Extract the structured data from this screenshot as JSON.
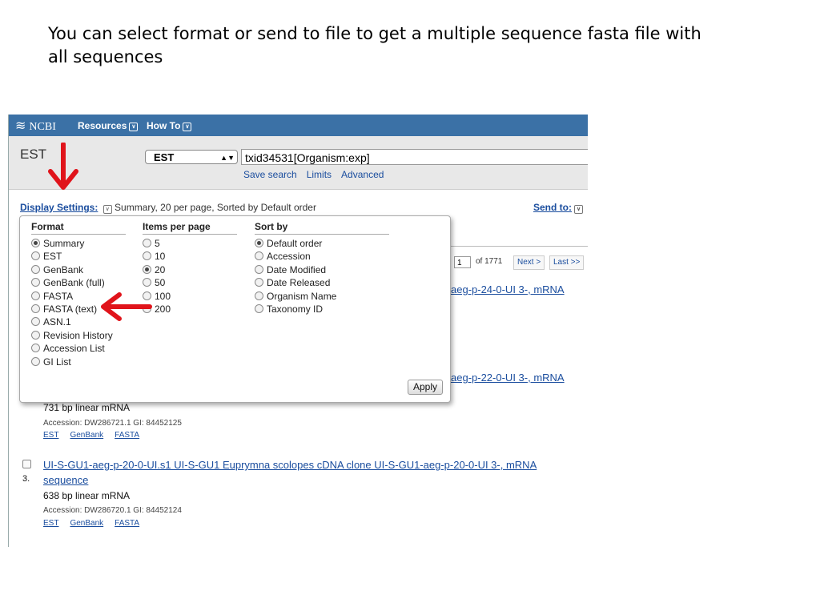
{
  "caption": "You can select format or send to file to get a multiple sequence fasta file with all sequences",
  "header": {
    "logo": "NCBI",
    "resources": "Resources",
    "howto": "How To"
  },
  "search": {
    "db_title": "EST",
    "db_select": "EST",
    "term": "txid34531[Organism:exp]",
    "save_search": "Save search",
    "limits": "Limits",
    "advanced": "Advanced"
  },
  "display": {
    "label": "Display Settings:",
    "summary": "Summary, 20 per page, Sorted by Default order",
    "send_to": "Send to:"
  },
  "pager": {
    "page": "1",
    "of": "of 1771",
    "next": "Next >",
    "last": "Last >>"
  },
  "panel": {
    "format_head": "Format",
    "format_options": [
      "Summary",
      "EST",
      "GenBank",
      "GenBank (full)",
      "FASTA",
      "FASTA (text)",
      "ASN.1",
      "Revision History",
      "Accession List",
      "GI List"
    ],
    "format_selected": "Summary",
    "items_head": "Items per page",
    "items_options": [
      "5",
      "10",
      "20",
      "50",
      "100",
      "200"
    ],
    "items_selected": "20",
    "sort_head": "Sort by",
    "sort_options": [
      "Default order",
      "Accession",
      "Date Modified",
      "Date Released",
      "Organism Name",
      "Taxonomy ID"
    ],
    "sort_selected": "Default order",
    "apply": "Apply"
  },
  "results": [
    {
      "title_tail": "aeg-p-24-0-UI 3-, mRNA"
    },
    {
      "title_tail": "aeg-p-22-0-UI 3-, mRNA",
      "meta": "731 bp linear mRNA",
      "acc": "Accession: DW286721.1   GI: 84452125",
      "links": [
        "EST",
        "GenBank",
        "FASTA"
      ]
    },
    {
      "number": "3.",
      "title_line1": "UI-S-GU1-aeg-p-20-0-UI.s1 UI-S-GU1 Euprymna scolopes cDNA clone UI-S-GU1-aeg-p-20-0-UI 3-, mRNA",
      "title_line2": "sequence",
      "meta": "638 bp linear mRNA",
      "acc": "Accession: DW286720.1   GI: 84452124",
      "links": [
        "EST",
        "GenBank",
        "FASTA"
      ]
    }
  ],
  "colors": {
    "topbar": "#3b71a6",
    "link": "#1a4d9e",
    "arrow": "#e0141b"
  }
}
